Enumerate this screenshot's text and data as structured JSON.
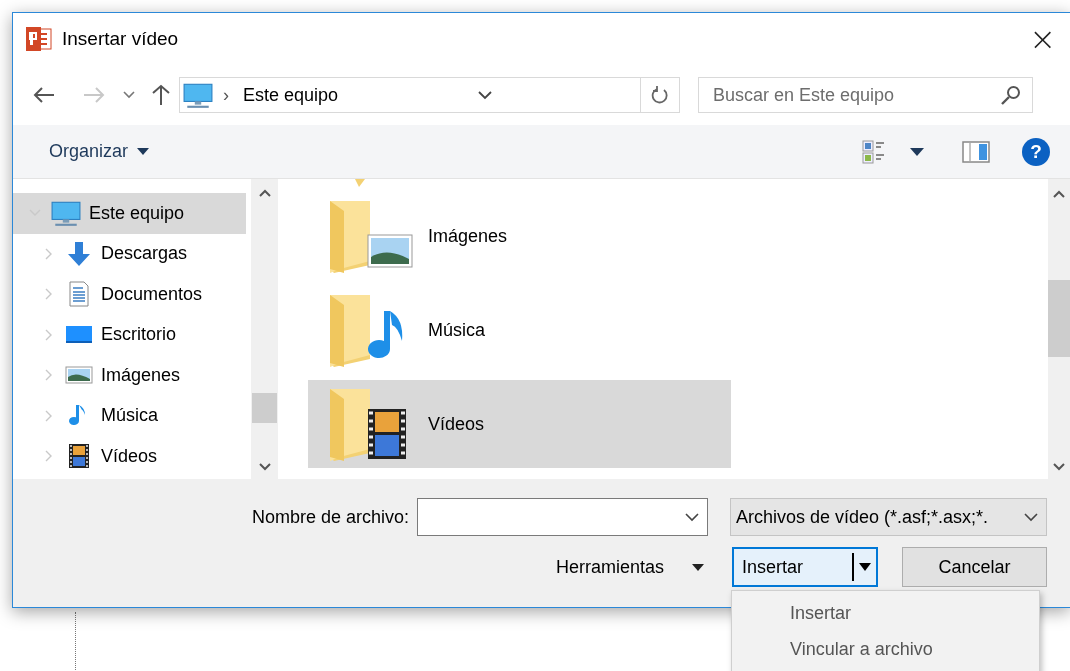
{
  "window": {
    "title": "Insertar vídeo",
    "close": "×"
  },
  "address_bar": {
    "separator": "›",
    "path": "Este equipo"
  },
  "search": {
    "placeholder": "Buscar en Este equipo"
  },
  "toolbar": {
    "organize": "Organizar",
    "help": "?"
  },
  "nav_tree": [
    {
      "label": "Este equipo",
      "kind": "computer",
      "selected": true,
      "expanded": true,
      "children": [
        {
          "label": "Descargas",
          "kind": "downloads",
          "selected": false,
          "expanded": false
        },
        {
          "label": "Documentos",
          "kind": "documents",
          "selected": false,
          "expanded": false
        },
        {
          "label": "Escritorio",
          "kind": "desktop",
          "selected": false,
          "expanded": false
        },
        {
          "label": "Imágenes",
          "kind": "pictures",
          "selected": false,
          "expanded": false
        },
        {
          "label": "Música",
          "kind": "music",
          "selected": false,
          "expanded": false
        },
        {
          "label": "Vídeos",
          "kind": "videos",
          "selected": false,
          "expanded": false
        }
      ]
    }
  ],
  "files": [
    {
      "name": "Imágenes",
      "kind": "pictures",
      "selected": false
    },
    {
      "name": "Música",
      "kind": "music",
      "selected": false
    },
    {
      "name": "Vídeos",
      "kind": "videos",
      "selected": true
    }
  ],
  "file_name": {
    "label": "Nombre de archivo:"
  },
  "file_type": "Archivos de vídeo (*.asf;*.asx;*.",
  "tools": "Herramientas",
  "buttons": [
    {
      "label": "Insertar",
      "kind": "split",
      "default": true
    },
    {
      "label": "Cancelar",
      "kind": "plain",
      "default": false
    }
  ],
  "insert_menu": [
    {
      "label": "Insertar"
    },
    {
      "label": "Vincular a archivo"
    }
  ]
}
